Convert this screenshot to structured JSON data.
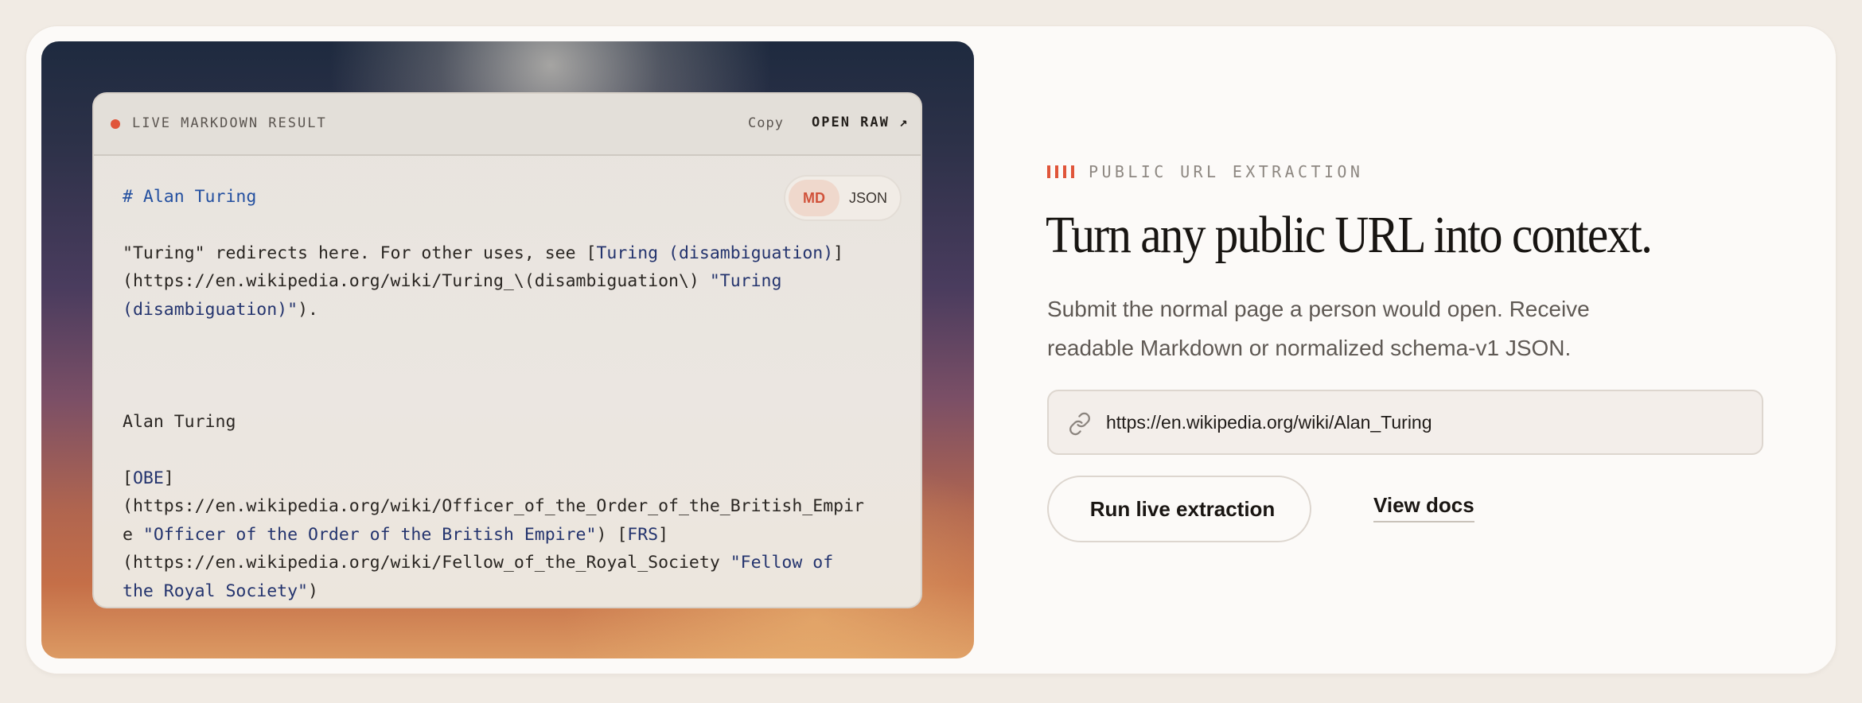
{
  "preview": {
    "header_label": "LIVE MARKDOWN RESULT",
    "copy_label": "Copy",
    "open_raw_label": "OPEN RAW ↗",
    "format_toggle": {
      "md_label": "MD",
      "json_label": "JSON",
      "selected": "MD"
    },
    "markdown": {
      "l1": "# Alan Turing",
      "l2a": "\"Turing\" redirects here. For other uses, see [",
      "l2b": "Turing (disambiguation)",
      "l2c": "]",
      "l3a": "(https://en.wikipedia.org/wiki/Turing_\\(disambiguation\\) ",
      "l3b": "\"Turing",
      "l4a": "(disambiguation)\"",
      "l4b": ").",
      "l5": "Alan Turing",
      "l6a": "[",
      "l6b": "OBE",
      "l6c": "]",
      "l7": "(https://en.wikipedia.org/wiki/Officer_of_the_Order_of_the_British_Empir",
      "l8a": "e ",
      "l8b": "\"Officer of the Order of the British Empire\"",
      "l8c": ") [",
      "l8d": "FRS",
      "l8e": "]",
      "l9a": "(https://en.wikipedia.org/wiki/Fellow_of_the_Royal_Society ",
      "l9b": "\"Fellow of",
      "l10a": "the Royal Society\"",
      "l10b": ")"
    }
  },
  "hero": {
    "eyebrow": "PUBLIC URL EXTRACTION",
    "headline": "Turn any public URL into context.",
    "subtitle": "Submit the normal page a person would open. Receive readable Markdown or normalized schema-v1 JSON.",
    "url_value": "https://en.wikipedia.org/wiki/Alan_Turing",
    "run_label": "Run live extraction",
    "docs_label": "View docs"
  },
  "colors": {
    "accent": "#e0553a",
    "link_blue": "#2450a0",
    "page_bg": "#f1ebe4",
    "card_bg": "#fcfaf8"
  },
  "icons": {
    "url_field": "link-icon",
    "status": "live-dot-icon"
  }
}
